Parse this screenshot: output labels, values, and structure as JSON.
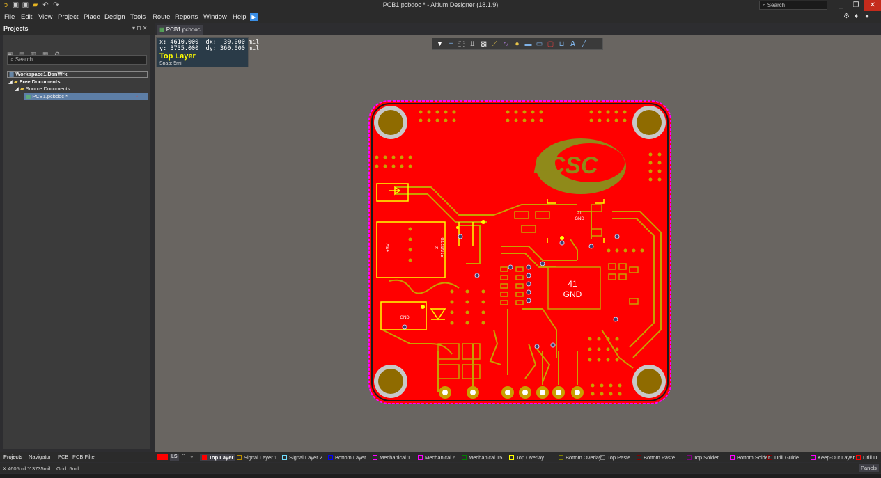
{
  "window": {
    "title": "PCB1.pcbdoc * - Altium Designer (18.1.9)",
    "search_placeholder": "Search",
    "minimize": "_",
    "restore": "❐",
    "close": "✕"
  },
  "menu": [
    "File",
    "Edit",
    "View",
    "Project",
    "Place",
    "Design",
    "Tools",
    "Route",
    "Reports",
    "Window",
    "Help"
  ],
  "panel": {
    "title": "Projects",
    "controls": "▾ ⊓ ✕",
    "search_placeholder": "Search",
    "tree": [
      {
        "label": "Workspace1.DsnWrk"
      },
      {
        "label": "Free Documents"
      },
      {
        "label": "Source Documents"
      },
      {
        "label": "PCB1.pcbdoc *"
      }
    ]
  },
  "document_tab": "PCB1.pcbdoc *",
  "hud": {
    "line1": "x: 4610.000  dx:  30.000 mil",
    "line2": "y: 3735.000  dy: 360.000 mil",
    "layer": "Top Layer",
    "snap": "Snap: 5mil"
  },
  "pcb": {
    "logo_text": "LCSC",
    "pad_label_1": "21",
    "pad_label_2": "GND",
    "ic_label_1": "41",
    "ic_label_2": "GND",
    "comp_label_1": "+5V",
    "comp_label_2a": "2",
    "comp_label_2b": "S1N1270",
    "comp_label_3": "GND"
  },
  "bottom_tabs": [
    "Projects",
    "Navigator",
    "PCB",
    "PCB Filter"
  ],
  "layer_bar": {
    "ls": "LS",
    "layers": [
      {
        "name": "Top Layer",
        "color": "#ff0000",
        "active": true
      },
      {
        "name": "Signal Layer 1",
        "color": "#bc8e00"
      },
      {
        "name": "Signal Layer 2",
        "color": "#70dbfa"
      },
      {
        "name": "Bottom Layer",
        "color": "#0000ff"
      },
      {
        "name": "Mechanical 1",
        "color": "#ff00ff"
      },
      {
        "name": "Mechanical 6",
        "color": "#ff00ff"
      },
      {
        "name": "Mechanical 15",
        "color": "#008000"
      },
      {
        "name": "Top Overlay",
        "color": "#ffff00"
      },
      {
        "name": "Bottom Overlay",
        "color": "#808000"
      },
      {
        "name": "Top Paste",
        "color": "#808080"
      },
      {
        "name": "Bottom Paste",
        "color": "#800000"
      },
      {
        "name": "Top Solder",
        "color": "#800080"
      },
      {
        "name": "Bottom Solder",
        "color": "#ff00ff"
      },
      {
        "name": "Drill Guide",
        "color": "#800000"
      },
      {
        "name": "Keep-Out Layer",
        "color": "#ff00ff"
      },
      {
        "name": "Drill D",
        "color": "#ff0000"
      }
    ]
  },
  "status": {
    "coords": "X:4605mil Y:3735mil",
    "grid": "Grid: 5mil",
    "panels_button": "Panels"
  },
  "colors": {
    "board": "#ff0000",
    "copper_trace": "#c8a000",
    "overlay": "#ffff00",
    "outline": "#ff00ff",
    "canvas": "#696561"
  }
}
